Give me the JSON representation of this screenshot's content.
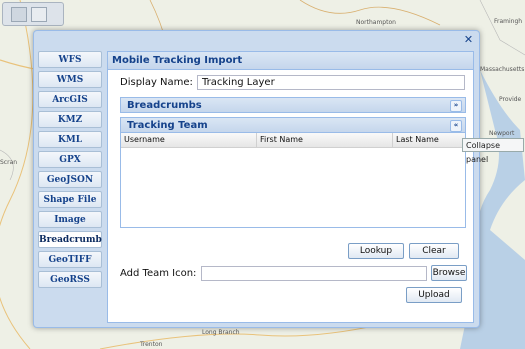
{
  "map": {
    "labels": [
      "Northampton",
      "Framingh",
      "Massachusetts",
      "Provide",
      "Newport",
      "Long Branch",
      "Trenton",
      "Scran"
    ]
  },
  "window": {
    "close_icon": "✕"
  },
  "nav": {
    "items": [
      {
        "label": "WFS"
      },
      {
        "label": "WMS"
      },
      {
        "label": "ArcGIS"
      },
      {
        "label": "KMZ"
      },
      {
        "label": "KML"
      },
      {
        "label": "GPX"
      },
      {
        "label": "GeoJSON"
      },
      {
        "label": "Shape File"
      },
      {
        "label": "Image"
      },
      {
        "label": "Breadcrumb"
      },
      {
        "label": "GeoTIFF"
      },
      {
        "label": "GeoRSS"
      }
    ],
    "active": "Breadcrumb"
  },
  "panel": {
    "title": "Mobile Tracking Import",
    "display_name_label": "Display Name:",
    "display_name_value": "Tracking Layer",
    "breadcrumbs_title": "Breadcrumbs",
    "breadcrumbs_toggle": "»",
    "tracking_title": "Tracking Team",
    "tracking_toggle": "«",
    "columns": [
      "Username",
      "First Name",
      "Last Name"
    ],
    "lookup_button": "Lookup",
    "clear_button": "Clear",
    "team_icon_label": "Add Team Icon:",
    "team_icon_value": "",
    "browse_button": "Browse",
    "upload_button": "Upload"
  },
  "tooltip": {
    "text": "Collapse panel"
  },
  "colors": {
    "accent": "#15428b",
    "border": "#99bbe8",
    "header_bg": "#c5d6ec"
  }
}
